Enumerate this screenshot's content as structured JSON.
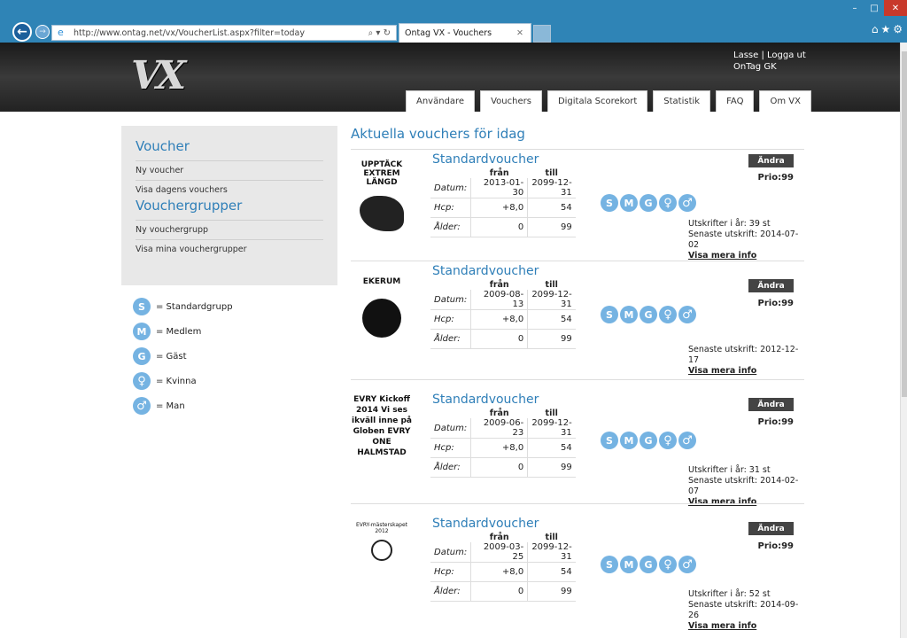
{
  "browser": {
    "url": "http://www.ontag.net/vx/VoucherList.aspx?filter=today",
    "tab_title": "Ontag VX - Vouchers",
    "search_tools": "⌕ ▾ ↻"
  },
  "site": {
    "logo": "VX",
    "user_line1": "Lasse | Logga ut",
    "user_line2": "OnTag GK",
    "menu": [
      "Användare",
      "Vouchers",
      "Digitala Scorekort",
      "Statistik",
      "FAQ",
      "Om VX"
    ]
  },
  "sidebar": {
    "voucher_heading": "Voucher",
    "voucher_links": [
      "Ny voucher",
      "Visa dagens vouchers"
    ],
    "group_heading": "Vouchergrupper",
    "group_links": [
      "Ny vouchergrupp",
      "Visa mina vouchergrupper"
    ]
  },
  "legend": [
    {
      "symbol": "S",
      "label": "= Standardgrupp"
    },
    {
      "symbol": "M",
      "label": "= Medlem"
    },
    {
      "symbol": "G",
      "label": "= Gäst"
    },
    {
      "symbol": "♀",
      "label": "= Kvinna"
    },
    {
      "symbol": "♂",
      "label": "= Man"
    }
  ],
  "main": {
    "heading": "Aktuella vouchers för idag",
    "col_from": "från",
    "col_to": "till",
    "row_labels": [
      "Datum:",
      "Hcp:",
      "Ålder:"
    ],
    "edit_label": "Ändra",
    "more_label": "Visa mera info",
    "vouchers": [
      {
        "title": "Standardvoucher",
        "date_from": "2013-01-30",
        "date_to": "2099-12-31",
        "hcp_from": "+8,0",
        "hcp_to": "54",
        "age_from": "0",
        "age_to": "99",
        "prio": "Prio:99",
        "prints": "Utskrifter i år: 39 st",
        "last_print": "Senaste utskrift: 2014-07-02",
        "thumb_text": "UPPTÄCK EXTREM LÄNGD"
      },
      {
        "title": "Standardvoucher",
        "date_from": "2009-08-13",
        "date_to": "2099-12-31",
        "hcp_from": "+8,0",
        "hcp_to": "54",
        "age_from": "0",
        "age_to": "99",
        "prio": "Prio:99",
        "prints": "",
        "last_print": "Senaste utskrift: 2012-12-17",
        "thumb_text": "EKERUM"
      },
      {
        "title": "Standardvoucher",
        "date_from": "2009-06-23",
        "date_to": "2099-12-31",
        "hcp_from": "+8,0",
        "hcp_to": "54",
        "age_from": "0",
        "age_to": "99",
        "prio": "Prio:99",
        "prints": "Utskrifter i år: 31 st",
        "last_print": "Senaste utskrift: 2014-02-07",
        "thumb_text": "EVRY Kickoff 2014 Vi ses ikväll inne på Globen EVRY ONE HALMSTAD"
      },
      {
        "title": "Standardvoucher",
        "date_from": "2009-03-25",
        "date_to": "2099-12-31",
        "hcp_from": "+8,0",
        "hcp_to": "54",
        "age_from": "0",
        "age_to": "99",
        "prio": "Prio:99",
        "prints": "Utskrifter i år: 52 st",
        "last_print": "Senaste utskrift: 2014-09-26",
        "thumb_text": "EVRY-mästerskapet 2012"
      }
    ]
  }
}
